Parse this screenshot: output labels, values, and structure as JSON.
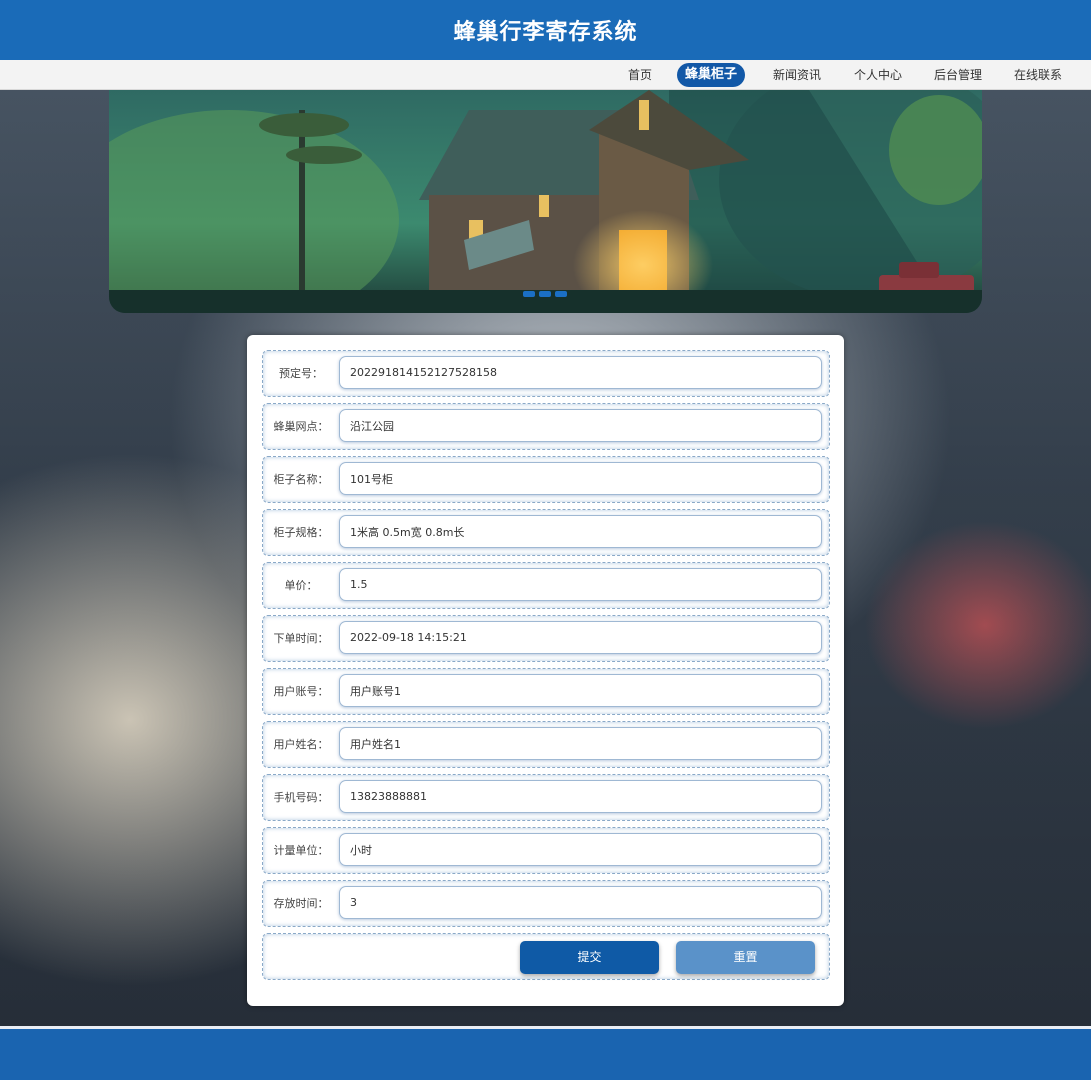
{
  "header": {
    "title": "蜂巢行李寄存系统"
  },
  "nav": {
    "items": [
      {
        "label": "首页",
        "active": false
      },
      {
        "label": "蜂巢柜子",
        "active": true
      },
      {
        "label": "新闻资讯",
        "active": false
      },
      {
        "label": "个人中心",
        "active": false
      },
      {
        "label": "后台管理",
        "active": false
      },
      {
        "label": "在线联系",
        "active": false
      }
    ]
  },
  "banner": {
    "slide_count": 3,
    "active_slide": 1
  },
  "form": {
    "fields": [
      {
        "label": "预定号：",
        "value": "202291814152127528158"
      },
      {
        "label": "蜂巢网点：",
        "value": "沿江公园"
      },
      {
        "label": "柜子名称：",
        "value": "101号柜"
      },
      {
        "label": "柜子规格：",
        "value": "1米高 0.5m宽 0.8m长"
      },
      {
        "label": "单价：",
        "value": "1.5"
      },
      {
        "label": "下单时间：",
        "value": "2022-09-18 14:15:21"
      },
      {
        "label": "用户账号：",
        "value": "用户账号1"
      },
      {
        "label": "用户姓名：",
        "value": "用户姓名1"
      },
      {
        "label": "手机号码：",
        "value": "13823888881"
      },
      {
        "label": "计量单位：",
        "value": "小时"
      },
      {
        "label": "存放时间：",
        "value": "3"
      }
    ],
    "submit_label": "提交",
    "reset_label": "重置"
  },
  "colors": {
    "header_bg": "#1a6bb8",
    "nav_active_bg": "#1258a7",
    "submit_bg": "#0f5aa6",
    "reset_bg": "#5a92c9",
    "footer_bg": "#1a64b0"
  }
}
